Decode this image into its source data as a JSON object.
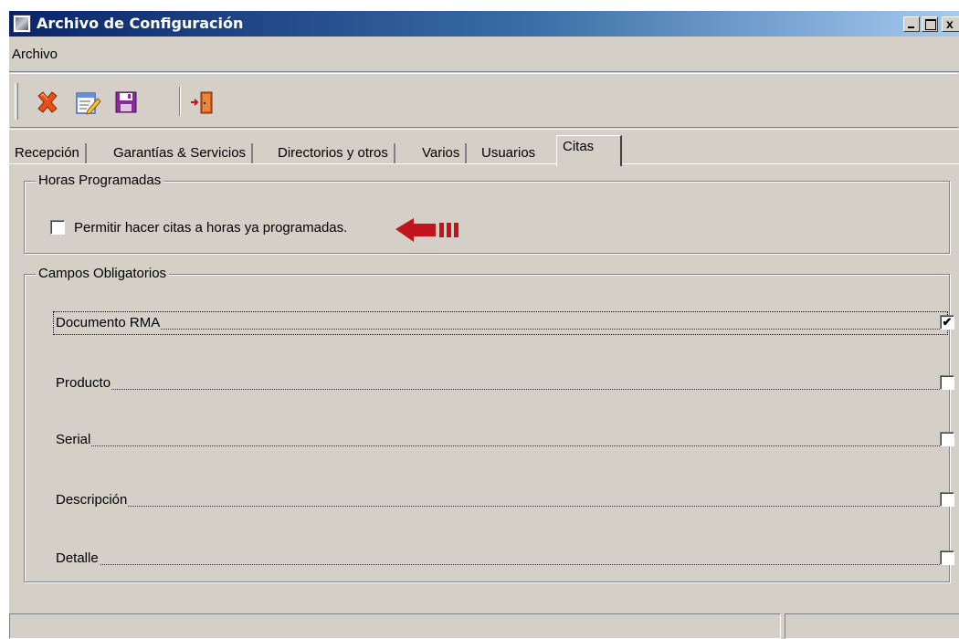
{
  "window": {
    "title": "Archivo de Configuración",
    "caption_buttons": [
      "minimize",
      "maximize",
      "close"
    ],
    "close_glyph": "x"
  },
  "menu": {
    "items": [
      "Archivo"
    ]
  },
  "toolbar": {
    "buttons": [
      {
        "icon": "delete-x-icon",
        "color": "#e8501a"
      },
      {
        "icon": "edit-note-icon",
        "color": "#3b66c4"
      },
      {
        "icon": "save-floppy-icon",
        "color": "#8a2a9c"
      },
      {
        "icon": "exit-door-icon",
        "color": "#d05a18"
      }
    ]
  },
  "tabs": {
    "items": [
      "Recepción",
      "Garantías & Servicios",
      "Directorios y otros",
      "Varios",
      "Usuarios",
      "Citas"
    ],
    "active": "Citas"
  },
  "horas_programadas": {
    "legend": "Horas Programadas",
    "checkbox_label": "Permitir hacer citas a horas ya programadas.",
    "checked": false,
    "annotation_arrow_color": "#c0151c"
  },
  "campos_obligatorios": {
    "legend": "Campos Obligatorios",
    "fields": [
      {
        "label": "Documento RMA",
        "checked": true,
        "mark": "✔"
      },
      {
        "label": "Producto",
        "checked": false,
        "mark": ""
      },
      {
        "label": "Serial",
        "checked": false,
        "mark": ""
      },
      {
        "label": "Descripción",
        "checked": false,
        "mark": ""
      },
      {
        "label": "Detalle",
        "checked": false,
        "mark": ""
      }
    ]
  },
  "statusbar": {
    "panes": [
      "",
      ""
    ]
  }
}
